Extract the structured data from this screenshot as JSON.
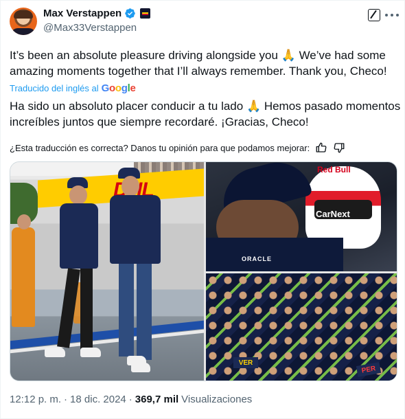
{
  "author": {
    "display_name": "Max Verstappen",
    "handle": "@Max33Verstappen",
    "verified": true
  },
  "tweet": {
    "original_text": "It’s been an absolute pleasure driving alongside you 🙏 We’ve had some amazing moments together that I’ll always remember. Thank you, Checo!",
    "translated_by_label": "Traducido del inglés al",
    "translator_brand": "Google",
    "translated_text": "Ha sido un absoluto placer conducir a tu lado 🙏 Hemos pasado momentos increíbles juntos que siempre recordaré. ¡Gracias, Checo!",
    "feedback_prompt": "¿Esta traducción es correcta? Danos tu opinión para que podamos mejorar:"
  },
  "media": {
    "left_banner_text": "DHL",
    "helmet_brand": "Red Bull",
    "helmet_sponsor": "CarNext",
    "shirt_sponsor": "ORACLE",
    "sign_1": "VER",
    "sign_2": "PER"
  },
  "meta": {
    "time": "12:12 p. m.",
    "separator": "·",
    "date": "18 dic. 2024",
    "separator2": "·",
    "views_count": "369,7 mil",
    "views_label": "Visualizaciones"
  },
  "colors": {
    "verified_blue": "#1d9bf0",
    "link_blue": "#1d9bf0",
    "muted_gray": "#536471",
    "dhl_yellow": "#ffcc00",
    "dhl_red": "#d40511"
  },
  "icons": {
    "verified": "verified-badge-icon",
    "affiliate": "red-bull-racing-badge-icon",
    "grok": "grok-icon",
    "more": "more-options-icon",
    "thumbs_up": "thumbs-up-icon",
    "thumbs_down": "thumbs-down-icon"
  }
}
